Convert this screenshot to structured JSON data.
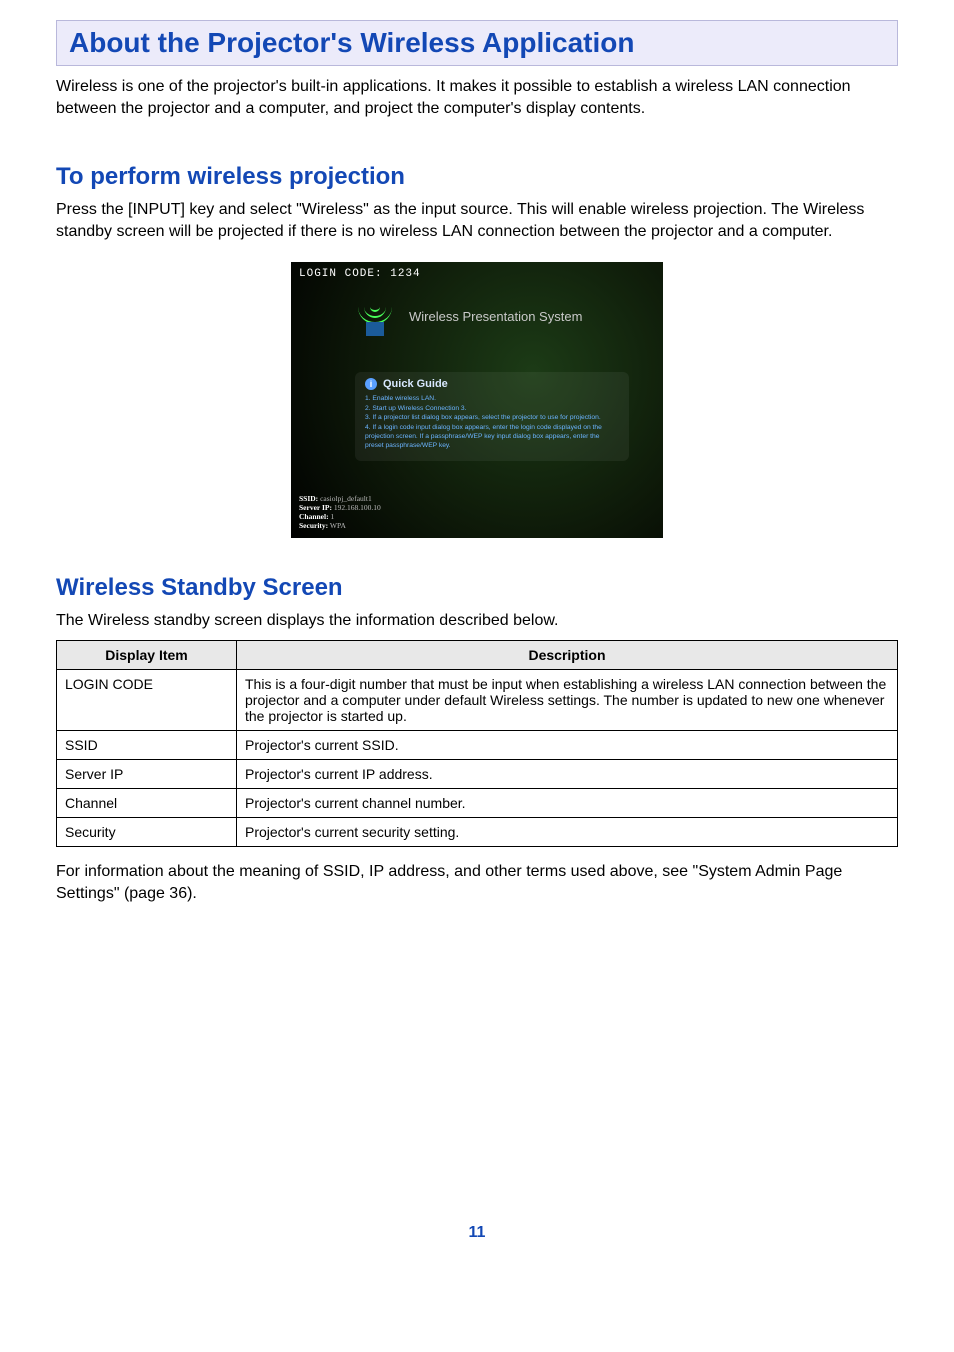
{
  "page": {
    "number": "11"
  },
  "hero": {
    "title": "About the Projector's Wireless Application"
  },
  "intro": {
    "text": "Wireless is one of the projector's built-in applications. It makes it possible to establish a wireless LAN connection between the projector and a computer, and project the computer's display contents."
  },
  "section_perform": {
    "title": "To perform wireless projection",
    "body": "Press the [INPUT] key and select \"Wireless\" as the input source. This will enable wireless projection. The Wireless standby screen will be projected if there is no wireless LAN connection between the projector and a computer."
  },
  "screenshot": {
    "login_code_line": "LOGIN CODE: 1234",
    "system_title": "Wireless Presentation System",
    "quick_guide_title": "Quick Guide",
    "quick_guide_steps": [
      "1. Enable wireless LAN.",
      "2. Start up Wireless Connection 3.",
      "3. If a projector list dialog box appears, select the projector to use for projection.",
      "4. If a login code input dialog box appears, enter the login code displayed on the projection screen. If a passphrase/WEP key input dialog box appears, enter the preset passphrase/WEP key."
    ],
    "info": {
      "ssid_label": "SSID:",
      "ssid_value": "casiolpj_default1",
      "server_ip_label": "Server IP:",
      "server_ip_value": "192.168.100.10",
      "channel_label": "Channel:",
      "channel_value": "1",
      "security_label": "Security:",
      "security_value": "WPA"
    }
  },
  "section_standby": {
    "title": "Wireless Standby Screen",
    "intro": "The Wireless standby screen displays the information described below.",
    "table": {
      "head_item": "Display Item",
      "head_desc": "Description",
      "rows": [
        {
          "item": "LOGIN CODE",
          "desc": "This is a four-digit number that must be input when establishing a wireless LAN connection between the projector and a computer under default Wireless settings. The number is updated to new one whenever the projector is started up."
        },
        {
          "item": "SSID",
          "desc": "Projector's current SSID."
        },
        {
          "item": "Server IP",
          "desc": "Projector's current IP address."
        },
        {
          "item": "Channel",
          "desc": "Projector's current channel number."
        },
        {
          "item": "Security",
          "desc": "Projector's current security setting."
        }
      ]
    },
    "outro": "For information about the meaning of SSID, IP address, and other terms used above, see \"System Admin Page Settings\" (page 36)."
  }
}
